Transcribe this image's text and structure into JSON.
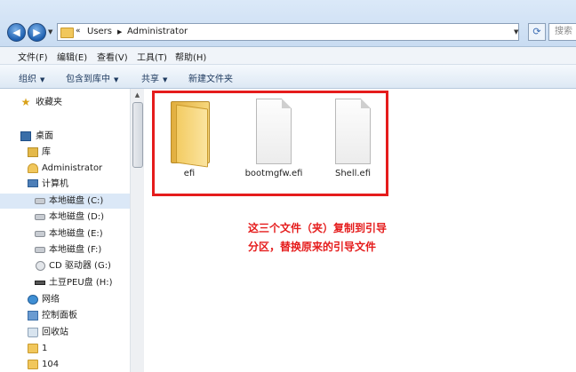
{
  "address_bar": {
    "crumbs": [
      "«",
      "Users",
      "Administrator"
    ],
    "search_placeholder": "搜索"
  },
  "menubar": {
    "items": [
      "文件(F)",
      "编辑(E)",
      "查看(V)",
      "工具(T)",
      "帮助(H)"
    ]
  },
  "command_bar": {
    "organize": "组织",
    "include_in_library": "包含到库中",
    "share": "共享",
    "new_folder": "新建文件夹"
  },
  "nav_pane": {
    "favorites": "收藏夹",
    "desktop": "桌面",
    "libraries": "库",
    "user": "Administrator",
    "computer": "计算机",
    "drives": [
      "本地磁盘 (C:)",
      "本地磁盘 (D:)",
      "本地磁盘 (E:)",
      "本地磁盘 (F:)",
      "CD 驱动器 (G:)",
      "土豆PEU盘 (H:)"
    ],
    "selected": "本地磁盘 (C:)",
    "network": "网络",
    "control_panel": "控制面板",
    "recycle_bin": "回收站",
    "folders": [
      "1",
      "104"
    ]
  },
  "files": [
    {
      "name": "efi",
      "type": "folder"
    },
    {
      "name": "bootmgfw.efi",
      "type": "file"
    },
    {
      "name": "Shell.efi",
      "type": "file"
    }
  ],
  "annotation": {
    "text": "这三个文件（夹）复制到引导分区，替换原来的引导文件",
    "color": "#e51c1c"
  }
}
